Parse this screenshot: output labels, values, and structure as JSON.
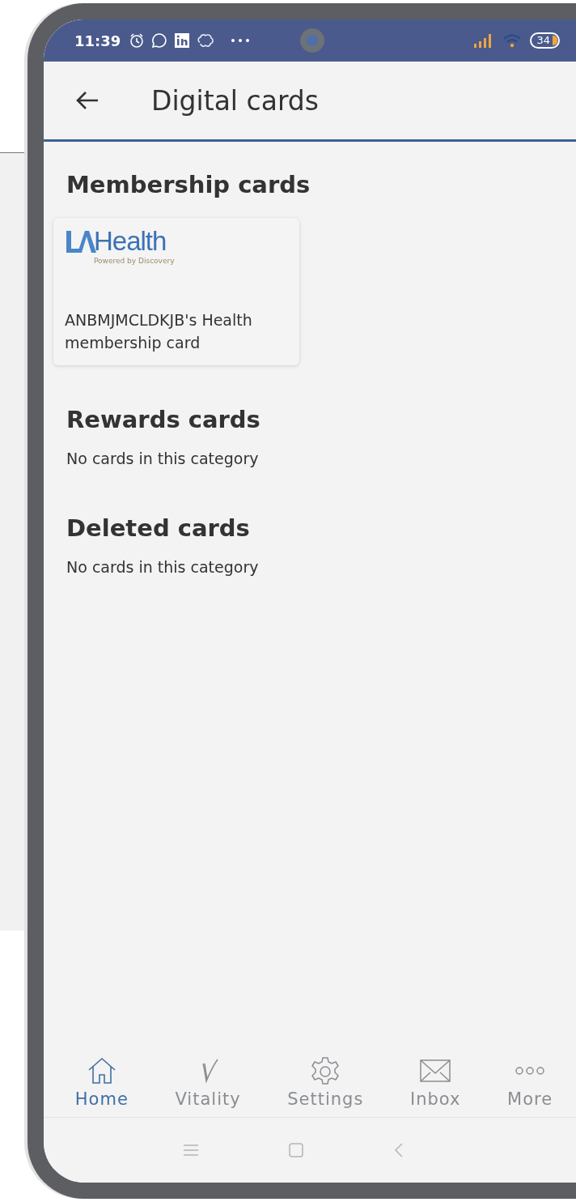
{
  "status_bar": {
    "time": "11:39",
    "battery": "34"
  },
  "header": {
    "title": "Digital cards"
  },
  "sections": [
    {
      "title": "Membership cards",
      "cards": [
        {
          "brand": "Health",
          "tagline": "Powered by Discovery",
          "name": "ANBMJMCLDKJB's Health membership card"
        }
      ]
    },
    {
      "title": "Rewards cards",
      "empty_text": "No cards in this category"
    },
    {
      "title": "Deleted cards",
      "empty_text": "No cards in this category"
    }
  ],
  "bottom_nav": [
    {
      "label": "Home",
      "kind": "home",
      "selected": true
    },
    {
      "label": "Vitality",
      "kind": "vitality",
      "selected": false
    },
    {
      "label": "Settings",
      "kind": "settings",
      "selected": false
    },
    {
      "label": "Inbox",
      "kind": "inbox",
      "selected": false
    },
    {
      "label": "More",
      "kind": "more",
      "selected": false
    }
  ]
}
